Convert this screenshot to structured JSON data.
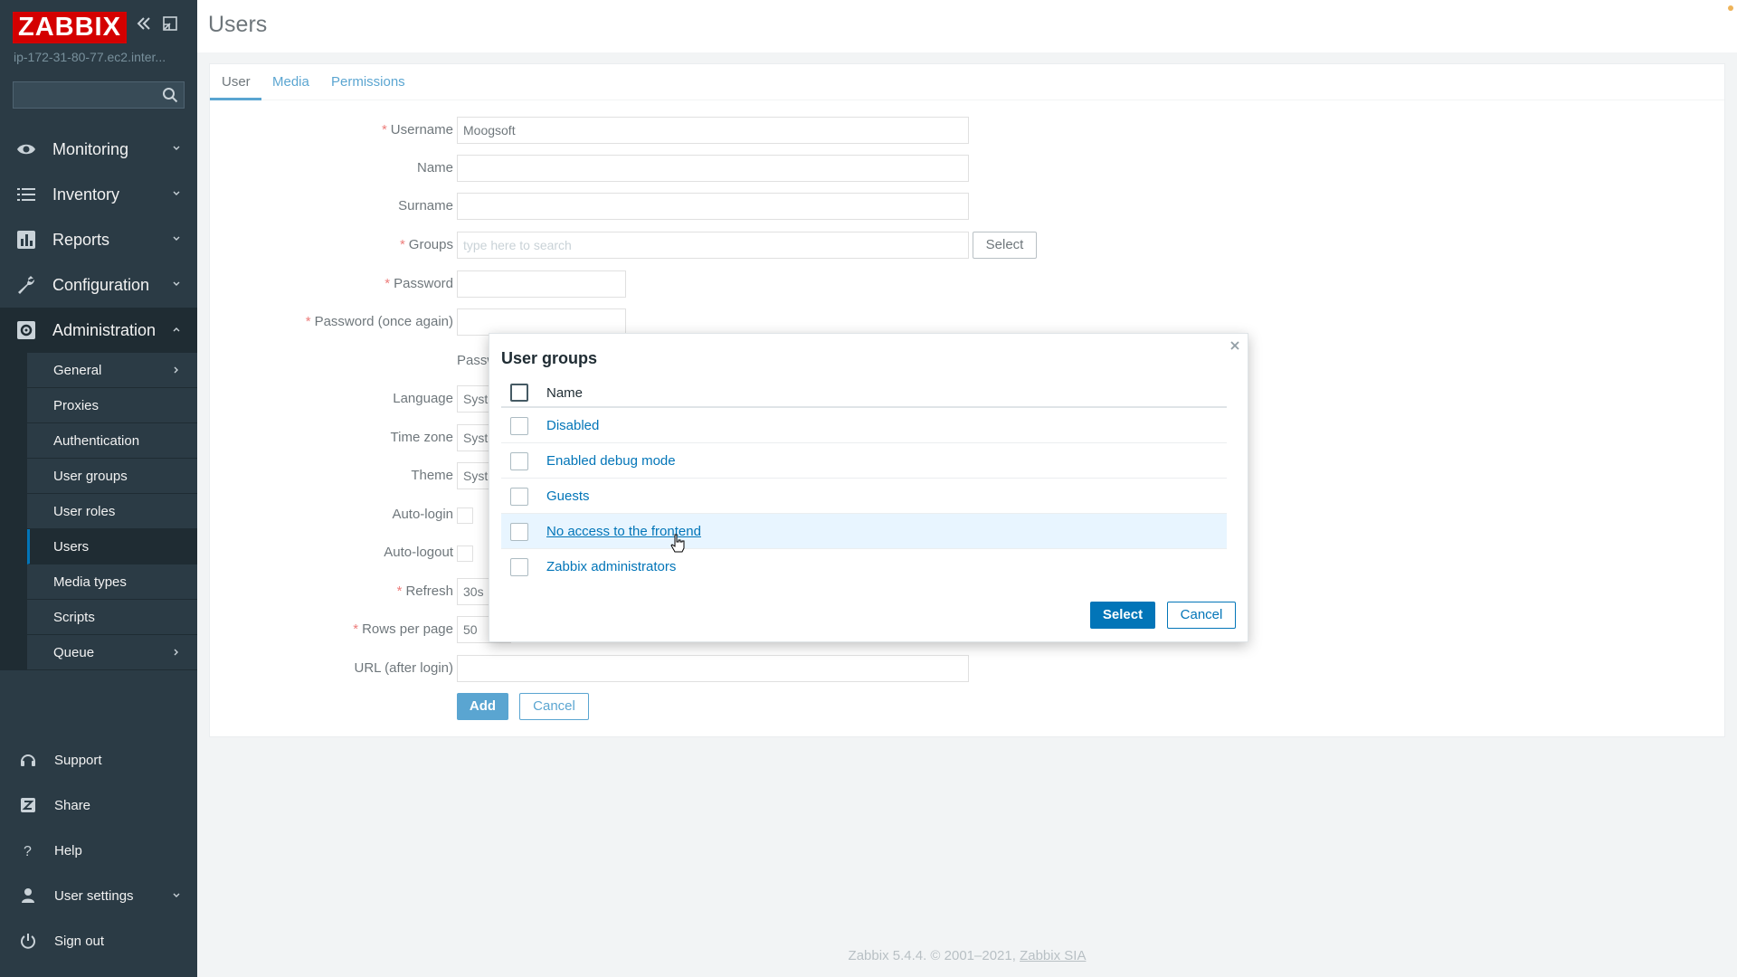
{
  "sidebar": {
    "logo": "ZABBIX",
    "server": "ip-172-31-80-77.ec2.inter...",
    "search_placeholder": "",
    "main": [
      {
        "label": "Monitoring",
        "icon": "eye-icon"
      },
      {
        "label": "Inventory",
        "icon": "list-icon"
      },
      {
        "label": "Reports",
        "icon": "bar-chart-icon"
      },
      {
        "label": "Configuration",
        "icon": "wrench-icon"
      },
      {
        "label": "Administration",
        "icon": "gear-icon"
      }
    ],
    "admin_sub": [
      {
        "label": "General"
      },
      {
        "label": "Proxies"
      },
      {
        "label": "Authentication"
      },
      {
        "label": "User groups"
      },
      {
        "label": "User roles"
      },
      {
        "label": "Users"
      },
      {
        "label": "Media types"
      },
      {
        "label": "Scripts"
      },
      {
        "label": "Queue"
      }
    ],
    "bottom": [
      {
        "label": "Support",
        "icon": "headset-icon"
      },
      {
        "label": "Share",
        "icon": "share-icon"
      },
      {
        "label": "Help",
        "icon": "help-icon"
      },
      {
        "label": "User settings",
        "icon": "user-icon"
      },
      {
        "label": "Sign out",
        "icon": "power-icon"
      }
    ]
  },
  "header": {
    "title": "Users"
  },
  "tabs": [
    "User",
    "Media",
    "Permissions"
  ],
  "form": {
    "username_label": "Username",
    "username_value": "Moogsoft",
    "name_label": "Name",
    "surname_label": "Surname",
    "groups_label": "Groups",
    "groups_placeholder": "type here to search",
    "groups_select": "Select",
    "password_label": "Password",
    "password2_label": "Password (once again)",
    "password_hint": "Passw",
    "language_label": "Language",
    "language_value": "Syst",
    "timezone_label": "Time zone",
    "timezone_value": "Syst",
    "theme_label": "Theme",
    "theme_value": "Syst",
    "autologin_label": "Auto-login",
    "autologout_label": "Auto-logout",
    "refresh_label": "Refresh",
    "refresh_value": "30s",
    "rows_label": "Rows per page",
    "rows_value": "50",
    "url_label": "URL (after login)",
    "add_button": "Add",
    "cancel_button": "Cancel"
  },
  "dialog": {
    "title": "User groups",
    "column_name": "Name",
    "rows": [
      "Disabled",
      "Enabled debug mode",
      "Guests",
      "No access to the frontend",
      "Zabbix administrators"
    ],
    "hovered_row": 3,
    "select_button": "Select",
    "cancel_button": "Cancel"
  },
  "footer": {
    "text": "Zabbix 5.4.4. © 2001–2021,",
    "link": "Zabbix SIA"
  },
  "colors": {
    "accent": "#0275b8",
    "sidebar": "#2b3b45",
    "logo": "#d40000",
    "required": "#e33734"
  }
}
